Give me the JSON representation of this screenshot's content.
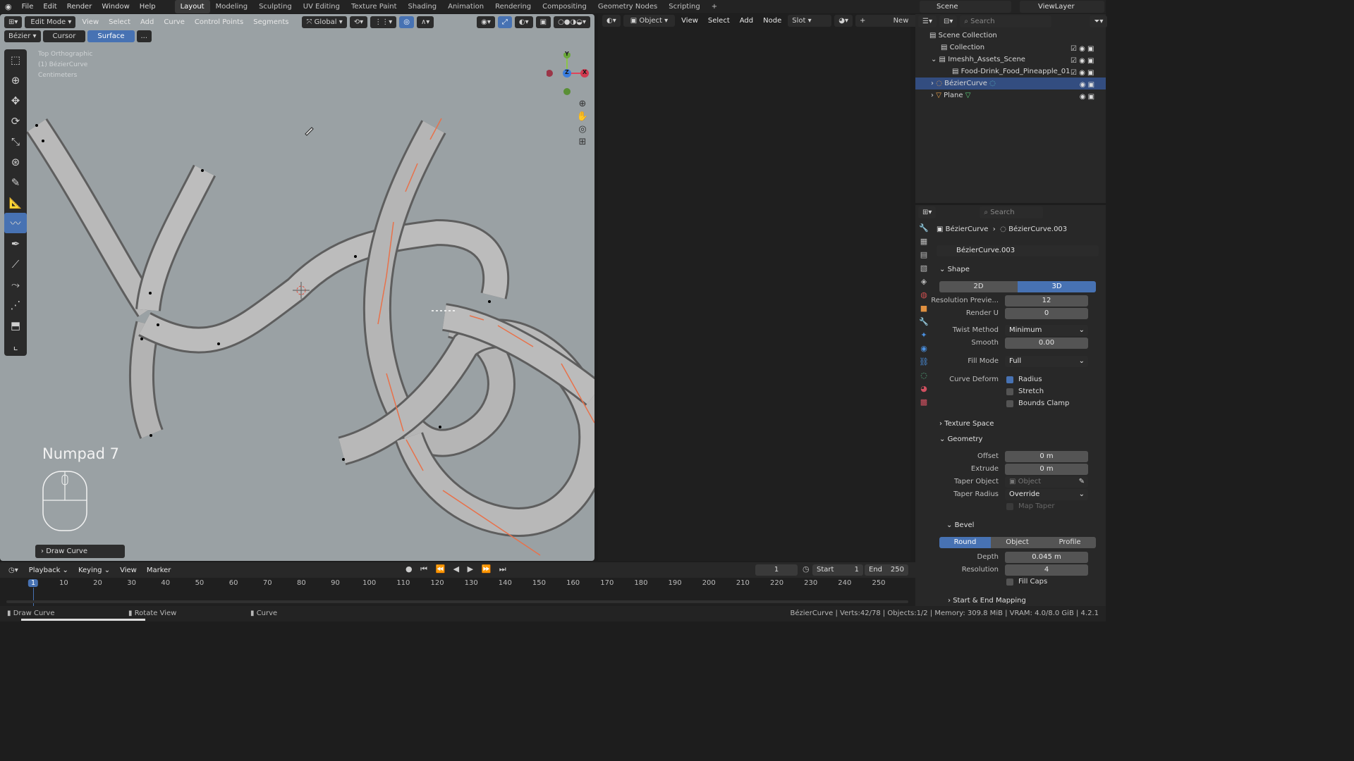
{
  "menubar": {
    "items": [
      "File",
      "Edit",
      "Render",
      "Window",
      "Help"
    ],
    "workspaces": [
      "Layout",
      "Modeling",
      "Sculpting",
      "UV Editing",
      "Texture Paint",
      "Shading",
      "Animation",
      "Rendering",
      "Compositing",
      "Geometry Nodes",
      "Scripting"
    ],
    "active_workspace": "Layout",
    "scene": "Scene",
    "view_layer": "ViewLayer"
  },
  "viewport": {
    "mode": "Edit Mode",
    "menus": [
      "View",
      "Select",
      "Add",
      "Curve",
      "Control Points",
      "Segments"
    ],
    "orientation": "Global",
    "sub_mode": "Bézier",
    "sub_tabs": [
      "Cursor",
      "Surface",
      "..."
    ],
    "overlay_lines": [
      "Top Orthographic",
      "(1) BézierCurve",
      "Centimeters"
    ],
    "key_hint": "Numpad 7",
    "operator_panel": "Draw Curve",
    "gizmo_axes": [
      "Y",
      "Z",
      "X"
    ]
  },
  "node_header": {
    "object": "Object",
    "menus": [
      "View",
      "Select",
      "Add",
      "Node"
    ],
    "slot": "Slot",
    "new_label": "New"
  },
  "outliner": {
    "search_placeholder": "Search",
    "items": [
      {
        "label": "Scene Collection"
      },
      {
        "label": "Collection"
      },
      {
        "label": "Imeshh_Assets_Scene"
      },
      {
        "label": "Food-Drink_Food_Pineapple_01"
      },
      {
        "label": "BézierCurve"
      },
      {
        "label": "Plane"
      }
    ]
  },
  "properties": {
    "search_placeholder": "Search",
    "breadcrumb": [
      "BézierCurve",
      "BézierCurve.003"
    ],
    "datablock": "BézierCurve.003",
    "shape_section": "Shape",
    "dim_2d": "2D",
    "dim_3d": "3D",
    "resolution_preview": {
      "label": "Resolution Previe...",
      "value": "12"
    },
    "render_u": {
      "label": "Render U",
      "value": "0"
    },
    "twist_method": {
      "label": "Twist Method",
      "value": "Minimum"
    },
    "smooth": {
      "label": "Smooth",
      "value": "0.00"
    },
    "fill_mode": {
      "label": "Fill Mode",
      "value": "Full"
    },
    "curve_deform": {
      "label": "Curve Deform",
      "radius": "Radius",
      "stretch": "Stretch",
      "bounds_clamp": "Bounds Clamp"
    },
    "texture_space": "Texture Space",
    "geometry_section": "Geometry",
    "offset": {
      "label": "Offset",
      "value": "0 m"
    },
    "extrude": {
      "label": "Extrude",
      "value": "0 m"
    },
    "taper_object": {
      "label": "Taper Object",
      "value": "Object"
    },
    "taper_radius": {
      "label": "Taper Radius",
      "value": "Override"
    },
    "map_taper": "Map Taper",
    "bevel_section": "Bevel",
    "bevel_tabs": [
      "Round",
      "Object",
      "Profile"
    ],
    "depth": {
      "label": "Depth",
      "value": "0.045 m"
    },
    "resolution": {
      "label": "Resolution",
      "value": "4"
    },
    "fill_caps": "Fill Caps",
    "start_end": "Start & End Mapping"
  },
  "timeline": {
    "menus": [
      "Playback",
      "Keying",
      "View",
      "Marker"
    ],
    "current_frame": "1",
    "start_label": "Start",
    "start": "1",
    "end_label": "End",
    "end": "250",
    "ticks": [
      "1",
      "10",
      "20",
      "30",
      "40",
      "50",
      "60",
      "70",
      "80",
      "90",
      "100",
      "110",
      "120",
      "130",
      "140",
      "150",
      "160",
      "170",
      "180",
      "190",
      "200",
      "210",
      "220",
      "230",
      "240",
      "250"
    ]
  },
  "statusbar": {
    "left": "Draw Curve",
    "middle": "Rotate View",
    "right_action": "Curve",
    "info": "BézierCurve | Verts:42/78 | Objects:1/2 | Memory: 309.8 MiB | VRAM: 4.0/8.0 GiB | 4.2.1"
  },
  "colors": {
    "accent": "#4772b3",
    "viewport_bg": "#9aa1a4",
    "panel_bg": "#282828"
  }
}
